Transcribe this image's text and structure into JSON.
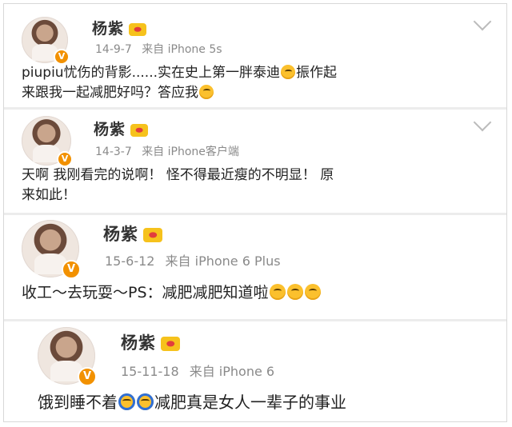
{
  "posts": [
    {
      "name": "杨紫",
      "date": "14-9-7",
      "source": "来自 iPhone 5s",
      "text_lines": [
        "piupiu忧伤的背影......实在史上第一胖泰迪",
        "振作起",
        "来跟我一起减肥好吗？答应我"
      ]
    },
    {
      "name": "杨紫",
      "date": "14-3-7",
      "source": "来自 iPhone客户端",
      "text_lines": [
        "天啊 我刚看完的说啊！ 怪不得最近瘦的不明显！ 原",
        "来如此！"
      ]
    },
    {
      "name": "杨紫",
      "date": "15-6-12",
      "source": "来自 iPhone 6 Plus",
      "text_lines": [
        "收工～去玩耍～PS：减肥减肥知道啦"
      ]
    },
    {
      "name": "杨紫",
      "date": "15-11-18",
      "source": "来自 iPhone 6",
      "text_lines": [
        "饿到睡不着",
        "减肥真是女人一辈子的事业"
      ]
    }
  ],
  "icons": {
    "verified_badge": "V",
    "member_badge": "crown-icon",
    "emoji": "emoji-icon",
    "menu": "chevron-down-icon"
  },
  "colors": {
    "badge": "#f29100",
    "crown": "#f6c21c",
    "meta": "#8a8a8a"
  }
}
